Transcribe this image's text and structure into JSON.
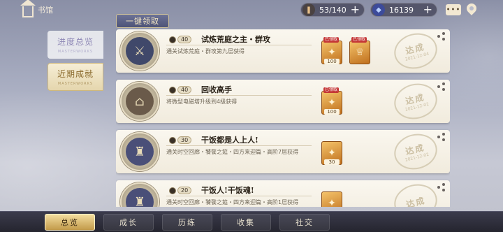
{
  "header": {
    "home_label": "书馆",
    "currencies": [
      {
        "name": "stamina",
        "icon": "scroll-icon",
        "value": "53/140"
      },
      {
        "name": "crystal",
        "icon": "crystal-icon",
        "value": "16139"
      }
    ]
  },
  "claim_all_label": "一键领取",
  "left_tabs": [
    {
      "label": "进度总览",
      "sub": "MASTERWORKS"
    },
    {
      "label": "近期成就",
      "sub": "MASTERWORKS"
    }
  ],
  "achievements": [
    {
      "title": "试炼荒庭之主・群攻",
      "points": "40",
      "description": "通关试炼荒庭・群攻第九层获得",
      "badge_icon": "crossed-swords-icon",
      "rewards": [
        {
          "claimed_label": "已领取",
          "qty": "100",
          "icon": "chest-icon"
        },
        {
          "claimed_label": "已领取",
          "qty": "",
          "icon": "chalice-icon"
        }
      ],
      "stamp_text": "达成",
      "stamp_date": "2021-12-04"
    },
    {
      "title": "回收高手",
      "points": "40",
      "description": "将微型电磁塔升级到4级获得",
      "badge_icon": "building-icon",
      "rewards": [
        {
          "claimed_label": "已领取",
          "qty": "100",
          "icon": "chest-icon"
        }
      ],
      "stamp_text": "达成",
      "stamp_date": "2021-12-02"
    },
    {
      "title": "干饭都是人上人!",
      "points": "30",
      "description": "通关时空回廊・饕餮之筵・四方来迎篇・高阶7层获得",
      "badge_icon": "tower-icon",
      "rewards": [
        {
          "claimed_label": "",
          "qty": "30",
          "icon": "chest-icon"
        }
      ],
      "stamp_text": "达成",
      "stamp_date": "2021-12-02"
    },
    {
      "title": "干饭人!干饭魂!",
      "points": "20",
      "description": "通关时空回廊・饕餮之筵・四方来迎篇・高阶1层获得",
      "badge_icon": "tower-icon",
      "rewards": [
        {
          "claimed_label": "",
          "qty": "",
          "icon": "chest-icon"
        }
      ],
      "stamp_text": "达成",
      "stamp_date": ""
    }
  ],
  "bottom_nav": [
    {
      "label": "总览",
      "active": true
    },
    {
      "label": "成长",
      "active": false
    },
    {
      "label": "历练",
      "active": false
    },
    {
      "label": "收集",
      "active": false
    },
    {
      "label": "社交",
      "active": false
    }
  ]
}
